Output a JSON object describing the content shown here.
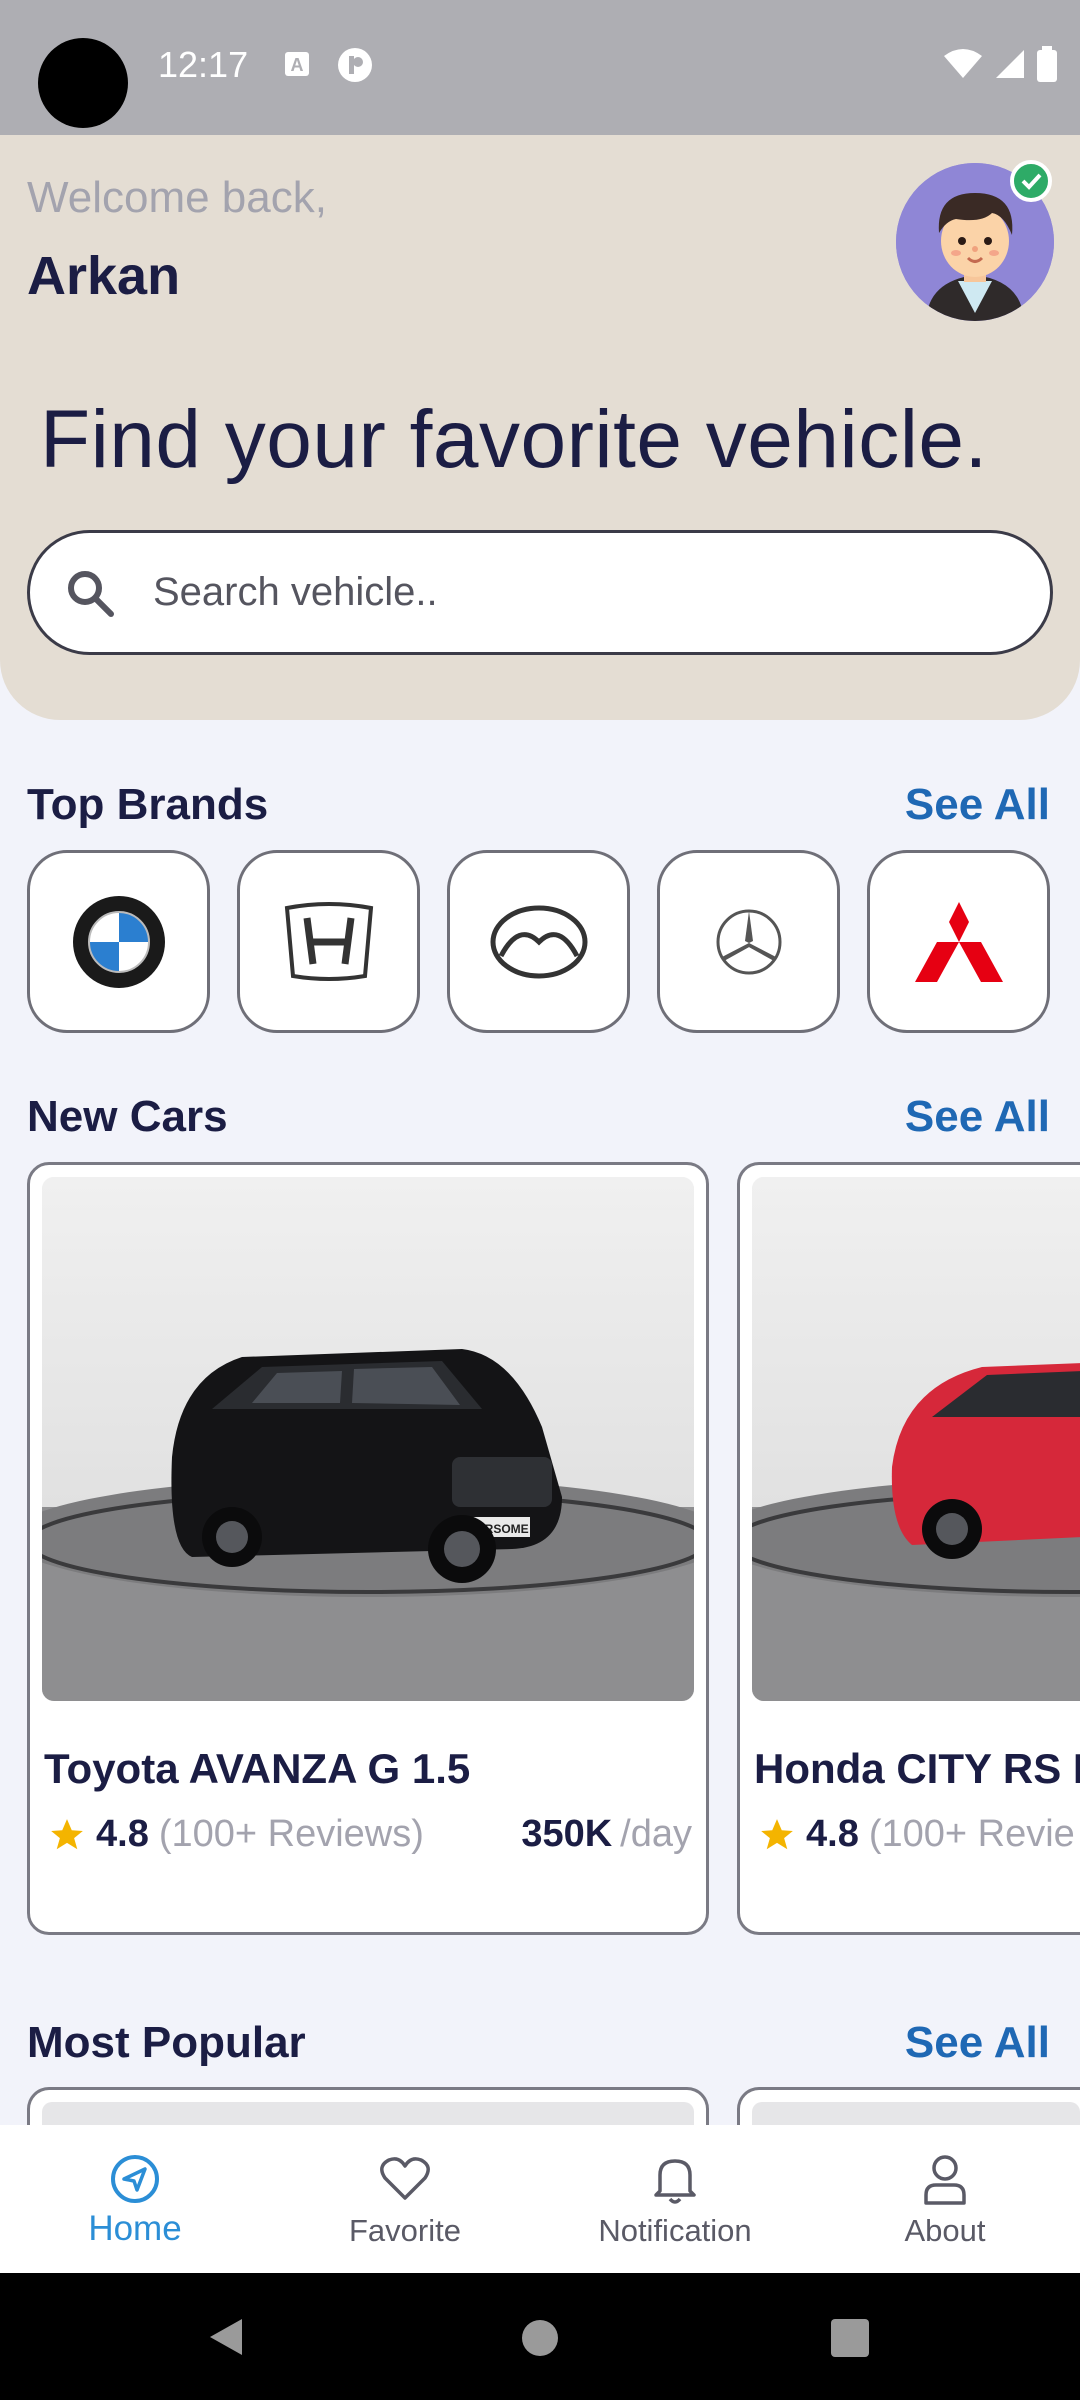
{
  "status_bar": {
    "time": "12:17"
  },
  "header": {
    "welcome": "Welcome back,",
    "username": "Arkan",
    "headline": "Find your favorite vehicle."
  },
  "search": {
    "placeholder": "Search vehicle.."
  },
  "top_brands": {
    "title": "Top Brands",
    "see_all": "See All",
    "brands": [
      "bmw-logo",
      "honda-logo",
      "mazda-logo",
      "mercedes-logo",
      "mitsubishi-logo"
    ]
  },
  "new_cars": {
    "title": "New Cars",
    "see_all": "See All",
    "cars": [
      {
        "name": "Toyota AVANZA G 1.5",
        "rating": "4.8",
        "reviews": "(100+ Reviews)",
        "price": "350K",
        "unit": "/day",
        "photo_label": "CARSOME"
      },
      {
        "name": "Honda CITY RS H",
        "rating": "4.8",
        "reviews": "(100+ Revie",
        "price": "",
        "unit": ""
      }
    ]
  },
  "most_popular": {
    "title": "Most Popular",
    "see_all": "See All"
  },
  "bottom_nav": [
    {
      "label": "Home",
      "active": true
    },
    {
      "label": "Favorite",
      "active": false
    },
    {
      "label": "Notification",
      "active": false
    },
    {
      "label": "About",
      "active": false
    }
  ],
  "colors": {
    "accent": "#1f68b4",
    "nav_active": "#2b8ed6",
    "header_bg": "#e4ddd3",
    "page_bg": "#f2f3fa"
  }
}
